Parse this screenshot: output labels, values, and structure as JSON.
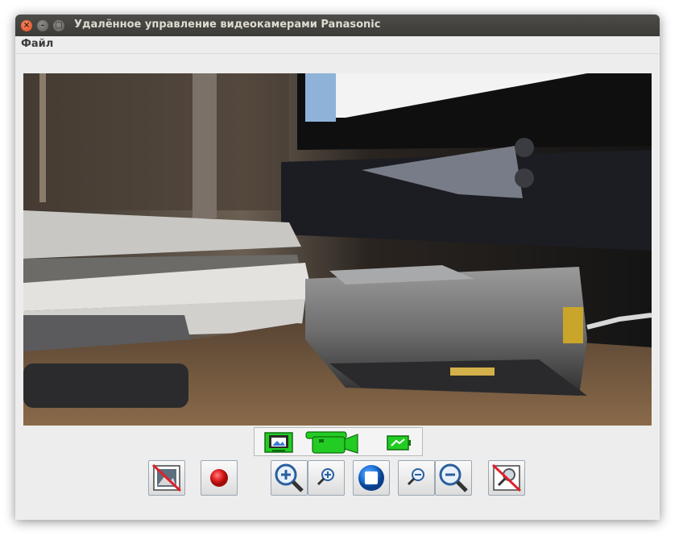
{
  "window": {
    "title": "Удалённое управление видеокамерами Panasonic",
    "controls": {
      "close": "×",
      "minimize": "–",
      "maximize": "□"
    }
  },
  "menubar": {
    "items": [
      {
        "label": "Файл"
      }
    ]
  },
  "video": {
    "content": "live camera preview"
  },
  "mode_switch": {
    "items": [
      {
        "icon": "photo-mode-icon",
        "selected": true
      },
      {
        "icon": "video-camera-mode-icon",
        "selected": false
      },
      {
        "icon": "battery-icon",
        "selected": false
      }
    ],
    "accent_color": "#22cc22"
  },
  "toolbar": {
    "buttons": [
      {
        "icon": "no-picture-icon"
      },
      {
        "icon": "record-icon",
        "color": "#e02020"
      },
      {
        "icon": "zoom-in-large-icon"
      },
      {
        "icon": "zoom-in-small-icon"
      },
      {
        "icon": "stop-icon",
        "color": "#1a6fd8"
      },
      {
        "icon": "zoom-out-small-icon"
      },
      {
        "icon": "zoom-out-large-icon"
      },
      {
        "icon": "no-zoom-icon"
      }
    ]
  }
}
